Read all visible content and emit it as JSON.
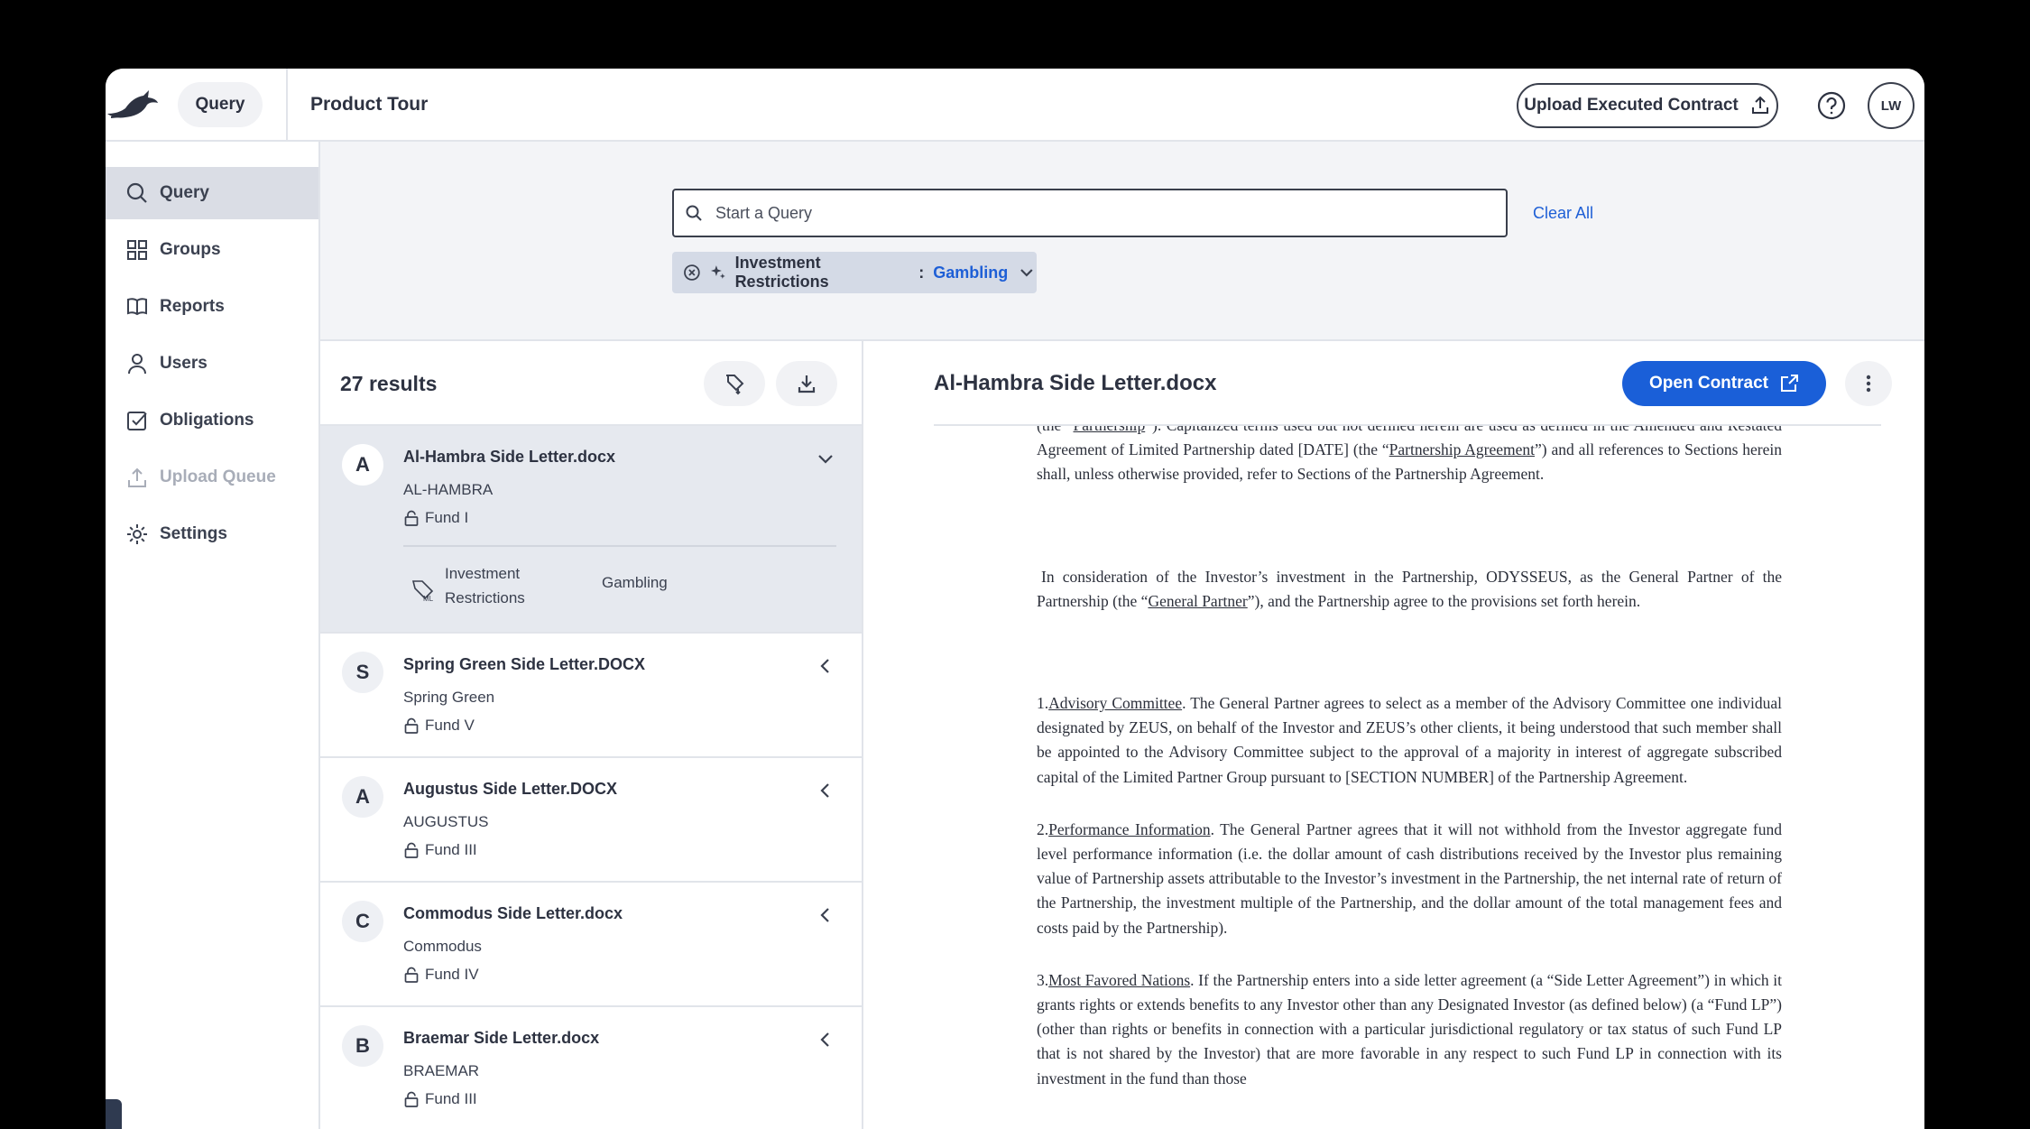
{
  "topbar": {
    "query_pill": "Query",
    "page_title": "Product Tour",
    "upload_label": "Upload Executed Contract",
    "avatar_initials": "LW"
  },
  "sidebar": {
    "items": [
      {
        "label": "Query",
        "icon": "search-icon",
        "state": "active"
      },
      {
        "label": "Groups",
        "icon": "grid-icon",
        "state": "normal"
      },
      {
        "label": "Reports",
        "icon": "book-icon",
        "state": "normal"
      },
      {
        "label": "Users",
        "icon": "user-icon",
        "state": "normal"
      },
      {
        "label": "Obligations",
        "icon": "checkbox-icon",
        "state": "normal"
      },
      {
        "label": "Upload Queue",
        "icon": "upload-icon",
        "state": "disabled"
      },
      {
        "label": "Settings",
        "icon": "gear-icon",
        "state": "normal"
      }
    ]
  },
  "search": {
    "placeholder": "Start a Query",
    "value": "",
    "clear_all": "Clear All",
    "filter": {
      "key": "Investment Restrictions",
      "separator": ":",
      "value": "Gambling"
    }
  },
  "results": {
    "count_label": "27 results",
    "items": [
      {
        "letter": "A",
        "title": "Al-Hambra Side Letter.docx",
        "party": "AL-HAMBRA",
        "fund": "Fund I",
        "expanded": true,
        "tag": {
          "label": "Investment Restrictions",
          "value": "Gambling",
          "icon_text": "ML"
        }
      },
      {
        "letter": "S",
        "title": "Spring Green Side Letter.DOCX",
        "party": "Spring Green",
        "fund": "Fund V",
        "expanded": false
      },
      {
        "letter": "A",
        "title": "Augustus Side Letter.DOCX",
        "party": "AUGUSTUS",
        "fund": "Fund III",
        "expanded": false
      },
      {
        "letter": "C",
        "title": "Commodus Side Letter.docx",
        "party": "Commodus",
        "fund": "Fund IV",
        "expanded": false
      },
      {
        "letter": "B",
        "title": "Braemar Side Letter.docx",
        "party": "BRAEMAR",
        "fund": "Fund III",
        "expanded": false
      }
    ]
  },
  "viewer": {
    "title": "Al-Hambra Side Letter.docx",
    "open_label": "Open Contract",
    "doc": {
      "p0_a": "(the “",
      "p0_link": "Partnership",
      "p0_b": "”). Capitalized terms used but not defined herein are used as defined in the Amended and Restated Agreement of Limited Partnership dated [DATE] (the “",
      "p0_link2": "Partnership Agreement",
      "p0_c": "”) and all references to Sections herein shall, unless otherwise provided, refer to Sections of the Partnership Agreement.",
      "p1_a": "In consideration of the Investor’s investment in the Partnership, ODYSSEUS, as the General Partner of the Partnership (the “",
      "p1_link": "General Partner",
      "p1_b": "”), and the Partnership agree to the provisions set forth herein.",
      "p2_num": "1.",
      "p2_head": "Advisory Committee",
      "p2_text": ".  The General Partner agrees to select as a member of the Advisory Committee one individual designated by ZEUS, on behalf of the Investor and ZEUS’s other clients, it being understood that such member shall be appointed to the Advisory Committee subject to the approval of a majority in interest of aggregate subscribed capital of the Limited Partner Group pursuant to [SECTION NUMBER] of the Partnership Agreement.",
      "p3_num": "2.",
      "p3_head": "Performance Information",
      "p3_text": ".  The General Partner agrees that it will not withhold from the Investor aggregate fund level performance information (i.e. the dollar amount of cash distributions received by the Investor plus remaining value of Partnership assets attributable to the Investor’s investment in the Partnership, the net internal rate of return of the Partnership, the investment multiple of the Partnership, and the dollar amount of the total management fees and costs paid by the Partnership).",
      "p4_num": "3.",
      "p4_head": "Most Favored Nations",
      "p4_text": ". If the Partnership enters into a side letter agreement (a “Side Letter Agreement”) in which it grants rights or extends benefits to any Investor other than any Designated Investor (as defined below) (a “Fund LP”) (other than rights or benefits in connection with a particular jurisdictional regulatory or tax status of such Fund LP that is not shared by the Investor) that are more favorable in any respect to such Fund LP in connection with its investment in the fund than those"
    }
  },
  "colors": {
    "accent": "#1a5fd8",
    "link": "#1e5fd6",
    "selected_row": "#e6e9ef",
    "active_nav": "#dadde5"
  }
}
